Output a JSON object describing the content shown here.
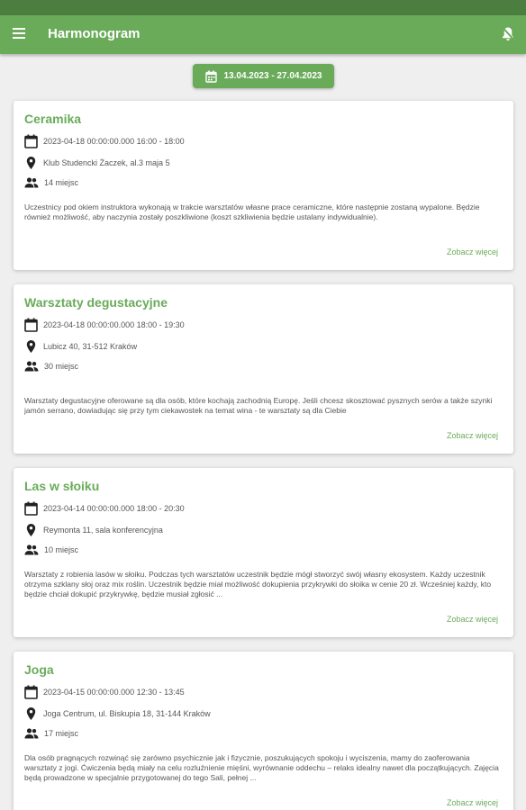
{
  "app": {
    "title": "Harmonogram",
    "colors": {
      "primary": "#6aab5a",
      "status_bar": "#4c7f3f",
      "background": "#efefef"
    },
    "icons": {
      "menu": "menu-icon",
      "notification": "bell-icon",
      "calendar": "calendar-icon",
      "location": "location-pin-icon",
      "people": "people-icon"
    }
  },
  "date_range": "13.04.2023 - 27.04.2023",
  "more_label": "Zobacz więcej",
  "events": [
    {
      "title": "Ceramika",
      "datetime": "2023-04-18 00:00:00.000 16:00 - 18:00",
      "location": "Klub Studencki Żaczek, al.3 maja 5",
      "seats": "14 miejsc",
      "description": "Uczestnicy pod okiem instruktora wykonają w trakcie warsztatów własne prace ceramiczne, które następnie zostaną wypalone. Będzie również możliwość, aby naczynia zostały poszkliwione (koszt szkliwienia będzie ustalany indywidualnie)."
    },
    {
      "title": "Warsztaty degustacyjne",
      "datetime": "2023-04-18 00:00:00.000 18:00 - 19:30",
      "location": "Lubicz 40, 31-512 Kraków",
      "seats": "30 miejsc",
      "description": "Warsztaty degustacyjne oferowane są dla osób, które kochają zachodnią Europę. Jeśli chcesz skosztować pysznych serów a także szynki jamón serrano, dowiadując się przy tym ciekawostek na temat wina - te warsztaty są dla Ciebie"
    },
    {
      "title": "Las w słoiku",
      "datetime": "2023-04-14 00:00:00.000 18:00 - 20:30",
      "location": "Reymonta 11, sala konferencyjna",
      "seats": "10 miejsc",
      "description": "Warsztaty z robienia lasów w słoiku. Podczas tych warsztatów uczestnik będzie mógł stworzyć swój własny ekosystem. Każdy uczestnik otrzyma szklany słoj oraz mix roślin. Uczestnik będzie miał możliwość dokupienia przykrywki do słoika w cenie 20 zł. Wcześniej każdy, kto będzie chciał dokupić przykrywkę, będzie musiał zgłosić ..."
    },
    {
      "title": "Joga",
      "datetime": "2023-04-15 00:00:00.000 12:30 - 13:45",
      "location": "Joga Centrum, ul. Biskupia 18, 31-144 Kraków",
      "seats": "17 miejsc",
      "description": "Dla osób pragnących rozwinąć się zarówno psychicznie jak i fizycznie, poszukujących spokoju i wyciszenia, mamy do zaoferowania warsztaty z jogi. Ćwiczenia będą miały na celu rozluźnienie mięśni, wyrównanie oddechu – relaks idealny nawet dla początkujących. Zajęcia będą prowadzone w specjalnie przygotowanej do tego Sali, pełnej ..."
    }
  ]
}
